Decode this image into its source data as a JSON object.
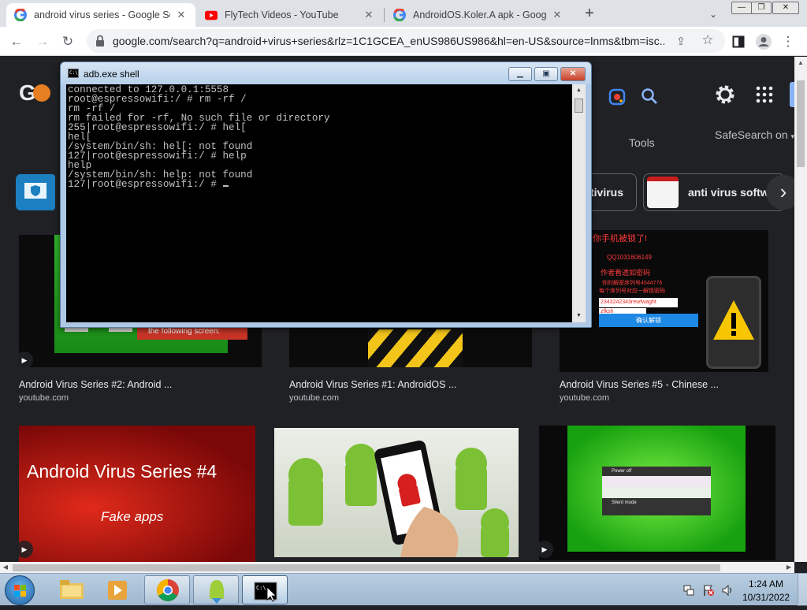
{
  "browser": {
    "tabs": [
      {
        "title": "android virus series - Google Sea",
        "favicon": "google-icon",
        "active": true
      },
      {
        "title": "FlyTech Videos - YouTube",
        "favicon": "youtube-icon",
        "active": false
      },
      {
        "title": "AndroidOS.Koler.A apk - Google",
        "favicon": "google-icon",
        "active": false
      }
    ],
    "url": "google.com/search?q=android+virus+series&rlz=1C1GCEA_enUS986US986&hl=en-US&source=lnms&tbm=isc..."
  },
  "google": {
    "tools_label": "Tools",
    "safesearch_label": "SafeSearch on",
    "chips": [
      {
        "label": "tivirus"
      },
      {
        "label": "anti virus softw"
      }
    ],
    "results": [
      {
        "caption": "Android Virus Series #2: Android ...",
        "source": "youtube.com",
        "overlay_text": "the following screen:"
      },
      {
        "caption": "Android Virus Series #1: AndroidOS ...",
        "source": "youtube.com"
      },
      {
        "caption": "Android Virus Series #5 - Chinese ...",
        "source": "youtube.com",
        "overlay_lines": [
          "被書你手机被锁了!",
          "QQ1031606149",
          "作者看透如密码",
          "你的解密序列号4544776",
          "每个序列号对应一解锁密码",
          "2343242343rewfwaght",
          "zfksh",
          "确认解锁"
        ]
      },
      {
        "overlay_title": "Android Virus Series #4",
        "overlay_subtitle": "Fake apps"
      },
      {},
      {
        "menu": [
          "Power off",
          "",
          "",
          "Silent mode"
        ]
      }
    ]
  },
  "console": {
    "title": "adb.exe  shell",
    "lines": [
      "connected to 127.0.0.1:5558",
      "root@espressowifi:/ # rm -rf /",
      "rm -rf /",
      "rm failed for -rf, No such file or directory",
      "255|root@espressowifi:/ # hel[",
      "hel[",
      "/system/bin/sh: hel[: not found",
      "127|root@espressowifi:/ # help",
      "help",
      "/system/bin/sh: help: not found",
      "127|root@espressowifi:/ #"
    ]
  },
  "taskbar": {
    "clock_time": "1:24 AM",
    "clock_date": "10/31/2022",
    "apps": [
      "explorer-icon",
      "media-player-icon",
      "chrome-icon",
      "android-apk-icon",
      "cmd-icon"
    ]
  },
  "colors": {
    "google_bg": "#202124",
    "console_bg": "#000000",
    "console_text": "#c0c0c0",
    "red_card": "#b71212",
    "green_card": "#3ec41a"
  }
}
